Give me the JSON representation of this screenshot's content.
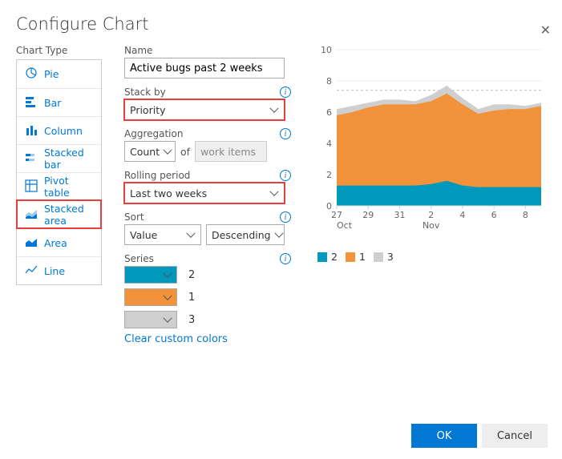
{
  "title": "Configure Chart",
  "sidebar_label": "Chart Type",
  "chart_types": [
    {
      "label": "Pie",
      "icon": "pie"
    },
    {
      "label": "Bar",
      "icon": "bar"
    },
    {
      "label": "Column",
      "icon": "column"
    },
    {
      "label": "Stacked bar",
      "icon": "stacked-bar"
    },
    {
      "label": "Pivot table",
      "icon": "pivot-table"
    },
    {
      "label": "Stacked area",
      "icon": "stacked-area",
      "selected": true
    },
    {
      "label": "Area",
      "icon": "area"
    },
    {
      "label": "Line",
      "icon": "line"
    }
  ],
  "form": {
    "name": {
      "label": "Name",
      "value": "Active bugs past 2 weeks"
    },
    "stack_by": {
      "label": "Stack by",
      "value": "Priority"
    },
    "aggregation": {
      "label": "Aggregation",
      "value": "Count",
      "joiner": "of",
      "subject": "work items"
    },
    "rolling": {
      "label": "Rolling period",
      "value": "Last two weeks"
    },
    "sort": {
      "label": "Sort",
      "field": "Value",
      "dir": "Descending"
    },
    "series": {
      "label": "Series",
      "items": [
        {
          "color": "#0099bc",
          "label": "2"
        },
        {
          "color": "#f2923a",
          "label": "1"
        },
        {
          "color": "#cfcfcf",
          "label": "3"
        }
      ]
    },
    "clear_link": "Clear custom colors"
  },
  "buttons": {
    "ok": "OK",
    "cancel": "Cancel"
  },
  "chart_data": {
    "type": "area",
    "stacked": true,
    "xlabel": "",
    "ylabel": "",
    "ylim": [
      0,
      10
    ],
    "yticks": [
      0,
      2,
      4,
      6,
      8,
      10
    ],
    "x_ticks": [
      "27",
      "29",
      "31",
      "2",
      "4",
      "6",
      "8"
    ],
    "x_month_labels": [
      "Oct",
      "Nov"
    ],
    "categories": [
      "27",
      "28",
      "29",
      "30",
      "31",
      "1",
      "2",
      "3",
      "4",
      "5",
      "6",
      "7",
      "8",
      "9"
    ],
    "series": [
      {
        "name": "2",
        "color": "#0099bc",
        "values": [
          1.3,
          1.3,
          1.3,
          1.3,
          1.3,
          1.3,
          1.4,
          1.6,
          1.3,
          1.2,
          1.2,
          1.2,
          1.2,
          1.2
        ]
      },
      {
        "name": "1",
        "color": "#f2923a",
        "values": [
          4.5,
          4.7,
          5.0,
          5.2,
          5.2,
          5.2,
          5.3,
          5.6,
          5.2,
          4.7,
          4.9,
          5.0,
          5.0,
          5.2
        ]
      },
      {
        "name": "3",
        "color": "#cfcfcf",
        "values": [
          0.4,
          0.4,
          0.3,
          0.3,
          0.3,
          0.2,
          0.4,
          0.5,
          0.4,
          0.3,
          0.4,
          0.3,
          0.2,
          0.2
        ]
      }
    ],
    "reference_line": 7.4,
    "legend": [
      "2",
      "1",
      "3"
    ]
  }
}
